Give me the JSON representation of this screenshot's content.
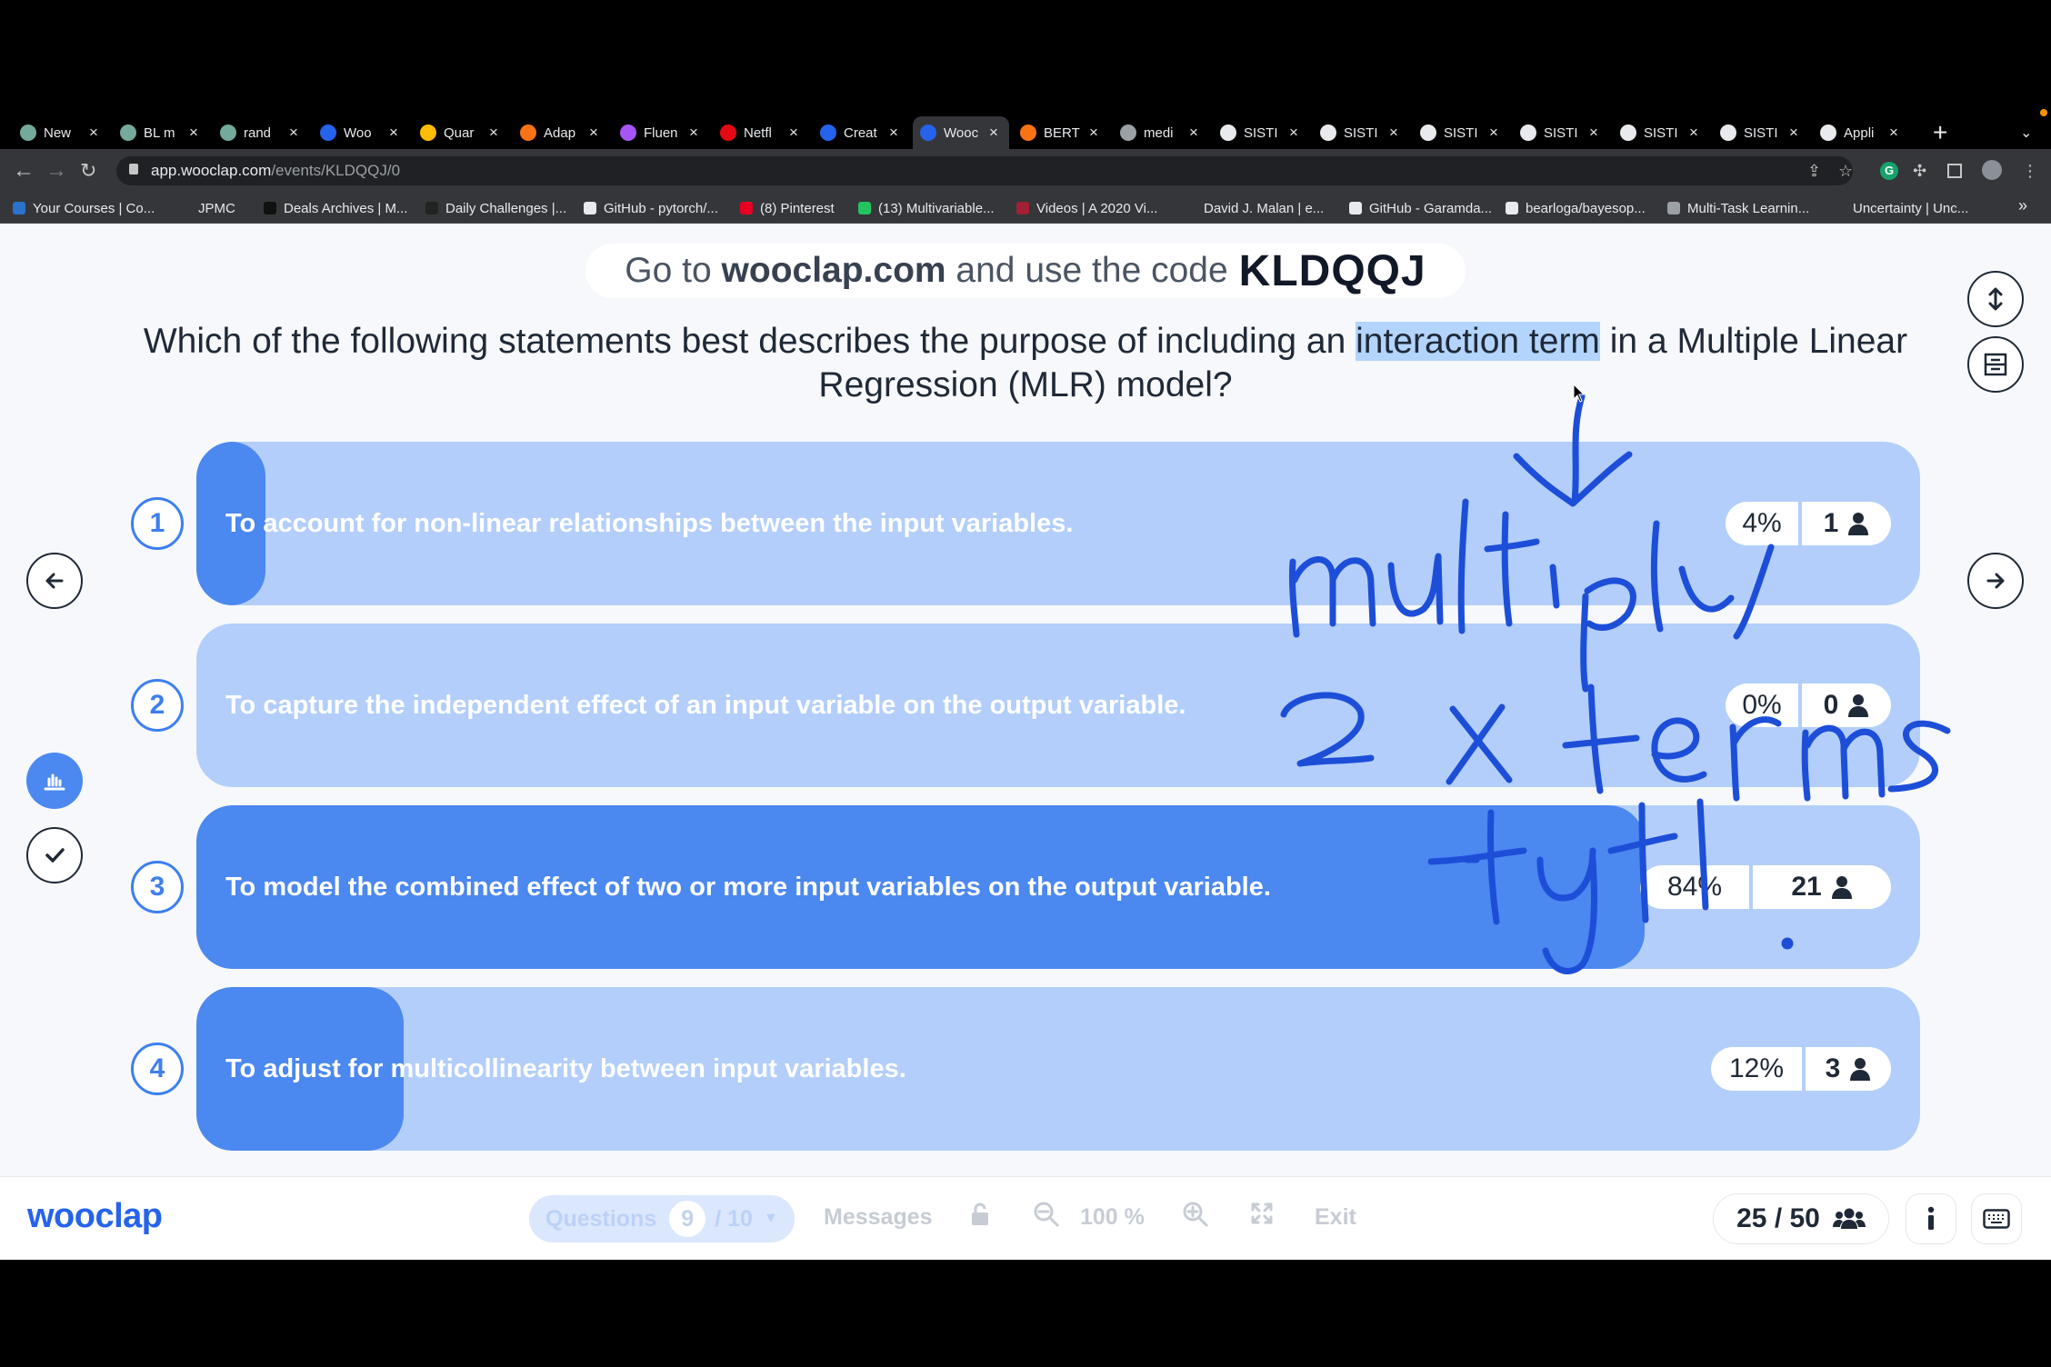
{
  "browser": {
    "tabs": [
      {
        "label": "New",
        "icon": "chatgpt-icon",
        "color": "#74aa9c"
      },
      {
        "label": "BL m",
        "icon": "chatgpt-icon",
        "color": "#74aa9c"
      },
      {
        "label": "rand",
        "icon": "chatgpt-icon",
        "color": "#74aa9c"
      },
      {
        "label": "Woo",
        "icon": "wooclap-icon",
        "color": "#2563eb"
      },
      {
        "label": "Quar",
        "icon": "google-drive-icon",
        "color": "#fbbc04"
      },
      {
        "label": "Adap",
        "icon": "infinity-icon",
        "color": "#f97316"
      },
      {
        "label": "Fluen",
        "icon": "app-icon",
        "color": "#a855f7"
      },
      {
        "label": "Netfl",
        "icon": "netflix-icon",
        "color": "#e50914"
      },
      {
        "label": "Creat",
        "icon": "wooclap-icon",
        "color": "#2563eb"
      },
      {
        "label": "Wooc",
        "icon": "wooclap-icon",
        "color": "#2563eb",
        "active": true
      },
      {
        "label": "BERT",
        "icon": "infinity-icon",
        "color": "#f97316"
      },
      {
        "label": "medi",
        "icon": "globe-icon",
        "color": "#9aa0a6"
      },
      {
        "label": "SISTI",
        "icon": "document-icon",
        "color": "#e8eaed"
      },
      {
        "label": "SISTI",
        "icon": "document-icon",
        "color": "#e8eaed"
      },
      {
        "label": "SISTI",
        "icon": "document-icon",
        "color": "#e8eaed"
      },
      {
        "label": "SISTI",
        "icon": "document-icon",
        "color": "#e8eaed"
      },
      {
        "label": "SISTI",
        "icon": "document-icon",
        "color": "#e8eaed"
      },
      {
        "label": "SISTI",
        "icon": "document-icon",
        "color": "#e8eaed"
      },
      {
        "label": "Appli",
        "icon": "app-icon",
        "color": "#e8eaed"
      }
    ],
    "url_host": "app.wooclap.com",
    "url_path": "/events/KLDQQJ/0",
    "bookmarks": [
      {
        "label": "Your Courses | Co...",
        "icon": "coursera-icon",
        "color": "#2a73cc"
      },
      {
        "label": "JPMC",
        "icon": "folder-icon",
        "color": "#35363a"
      },
      {
        "label": "Deals Archives | M...",
        "icon": "bookmark-icon",
        "color": "#111"
      },
      {
        "label": "Daily Challenges |...",
        "icon": "bookmark-icon",
        "color": "#222"
      },
      {
        "label": "GitHub - pytorch/...",
        "icon": "github-icon",
        "color": "#e8eaed"
      },
      {
        "label": "(8) Pinterest",
        "icon": "pinterest-icon",
        "color": "#e60023"
      },
      {
        "label": "(13) Multivariable...",
        "icon": "vimeo-icon",
        "color": "#22c55e"
      },
      {
        "label": "Videos | A 2020 Vi...",
        "icon": "mit-icon",
        "color": "#a31f34"
      },
      {
        "label": "David J. Malan | e...",
        "icon": "x-icon",
        "color": "#35363a"
      },
      {
        "label": "GitHub - Garamda...",
        "icon": "github-icon",
        "color": "#e8eaed"
      },
      {
        "label": "bearloga/bayesop...",
        "icon": "github-icon",
        "color": "#e8eaed"
      },
      {
        "label": "Multi-Task Learnin...",
        "icon": "globe-icon",
        "color": "#9aa0a6"
      },
      {
        "label": "Uncertainty | Unc...",
        "icon": "x-icon",
        "color": "#35363a"
      }
    ]
  },
  "page": {
    "banner_prefix": "Go to",
    "banner_site": "wooclap.com",
    "banner_middle": "and use the code",
    "banner_code": "KLDQQJ",
    "question_before": "Which of the following statements best describes the purpose of including an",
    "question_highlight": "interaction term",
    "question_after": "in a Multiple Linear Regression (MLR) model?",
    "answers": [
      {
        "number": "1",
        "text": "To account for non-linear relationships between the input variables.",
        "percent": "4%",
        "count": "1",
        "share": 0.04
      },
      {
        "number": "2",
        "text": "To capture the independent effect of an input variable on the output variable.",
        "percent": "0%",
        "count": "0",
        "share": 0.0
      },
      {
        "number": "3",
        "text": "To model the combined effect of two or more input variables on the output variable.",
        "percent": "84%",
        "count": "21",
        "share": 0.84
      },
      {
        "number": "4",
        "text": "To adjust for multicollinearity between input variables.",
        "percent": "12%",
        "count": "3",
        "share": 0.12
      }
    ],
    "handwriting": [
      "multiply",
      "2 x terms",
      "+y+!"
    ]
  },
  "bottom": {
    "logo": "wooclap",
    "questions_label": "Questions",
    "question_current": "9",
    "question_total": "/ 10",
    "messages": "Messages",
    "zoom": "100 %",
    "exit": "Exit",
    "participants": "25 / 50"
  },
  "colors": {
    "accent": "#4b88ef",
    "answer_bg": "#b3cefa",
    "annotation": "#1d4ed8"
  }
}
